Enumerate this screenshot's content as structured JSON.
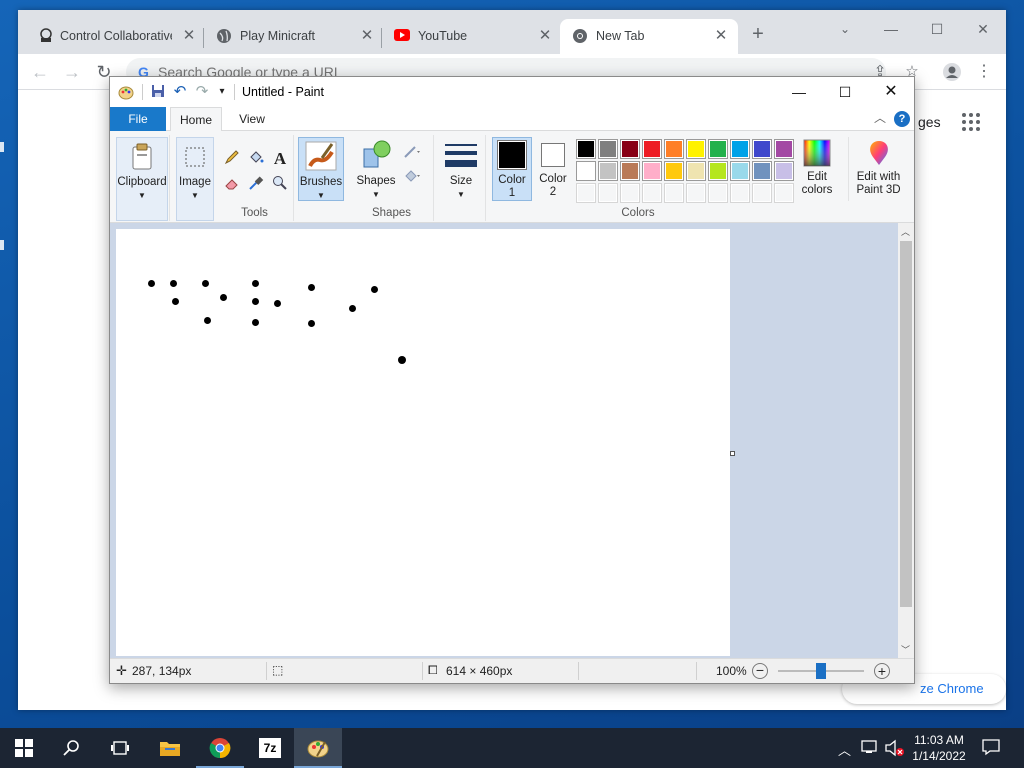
{
  "chrome": {
    "tabs": [
      {
        "title": "Control Collaborative",
        "icon": "collaborative-icon"
      },
      {
        "title": "Play Minicraft",
        "icon": "globe-icon"
      },
      {
        "title": "YouTube",
        "icon": "youtube-icon"
      },
      {
        "title": "New Tab",
        "icon": "chrome-icon"
      }
    ],
    "tab_close": "✕",
    "new_tab": "+",
    "omnibox_placeholder": "Search Google or type a URL",
    "google_images_partial": "ges",
    "customize_label": "ze Chrome"
  },
  "paint": {
    "title": "Untitled - Paint",
    "ribbon_tabs": {
      "file": "File",
      "home": "Home",
      "view": "View"
    },
    "groups": {
      "clipboard": "Clipboard",
      "image": "Image",
      "tools": "Tools",
      "brushes": "Brushes",
      "shapes_btn": "Shapes",
      "shapes_group": "Shapes",
      "size": "Size",
      "color1": "Color\n1",
      "color2": "Color\n2",
      "colors_group": "Colors",
      "edit_colors": "Edit\ncolors",
      "edit_paint3d": "Edit with\nPaint 3D"
    },
    "palette_row1": [
      "#000000",
      "#7f7f7f",
      "#880015",
      "#ed1c24",
      "#ff7f27",
      "#fff200",
      "#22b14c",
      "#00a2e8",
      "#3f48cc",
      "#a349a4"
    ],
    "palette_row2": [
      "#ffffff",
      "#c3c3c3",
      "#b97a57",
      "#ffaec9",
      "#ffc90e",
      "#efe4b0",
      "#b5e61d",
      "#99d9ea",
      "#7092be",
      "#c8bfe7"
    ],
    "color1": "#000000",
    "color2": "#ffffff",
    "status": {
      "cursor_pos": "287, 134px",
      "selection_size": "",
      "canvas_size": "614 × 460px",
      "zoom": "100%"
    }
  },
  "taskbar": {
    "time": "11:03 AM",
    "date": "1/14/2022"
  }
}
